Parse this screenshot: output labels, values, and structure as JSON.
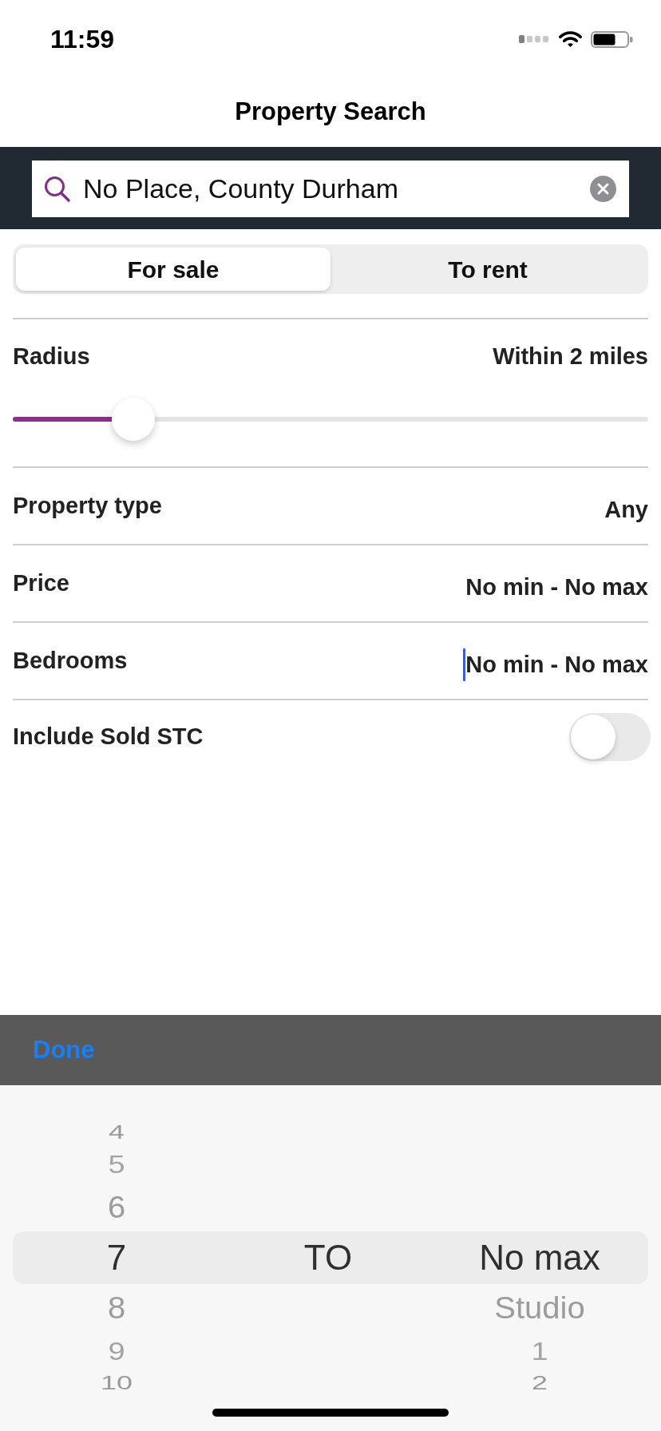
{
  "status_bar": {
    "time": "11:59"
  },
  "nav": {
    "title": "Property Search"
  },
  "search": {
    "value": "No Place, County Durham"
  },
  "tabs": [
    {
      "label": "For sale",
      "selected": true
    },
    {
      "label": "To rent",
      "selected": false
    }
  ],
  "filters": [
    {
      "kind": "slider",
      "label": "Radius",
      "value": "Within 2 miles",
      "level": 0.19
    },
    {
      "kind": "select",
      "label": "Property type",
      "value": "Any",
      "focused": false
    },
    {
      "kind": "select",
      "label": "Price",
      "value": "No min - No max",
      "focused": false
    },
    {
      "kind": "select",
      "label": "Bedrooms",
      "value": "No min - No max",
      "focused": true
    },
    {
      "kind": "toggle",
      "label": "Include Sold STC",
      "on": false
    }
  ],
  "picker": {
    "toolbar": {
      "done": "Done"
    },
    "columns": [
      {
        "kind": "wheel",
        "items": [
          {
            "label": "4",
            "selected": false
          },
          {
            "label": "5",
            "selected": false
          },
          {
            "label": "6",
            "selected": false
          },
          {
            "label": "7",
            "selected": true
          },
          {
            "label": "8",
            "selected": false
          },
          {
            "label": "9",
            "selected": false
          },
          {
            "label": "10",
            "selected": false
          }
        ]
      },
      {
        "kind": "label",
        "text": "TO"
      },
      {
        "kind": "wheel",
        "items": [
          {
            "label": "No max",
            "selected": true
          },
          {
            "label": "Studio",
            "selected": false
          },
          {
            "label": "1",
            "selected": false
          },
          {
            "label": "2",
            "selected": false
          }
        ]
      }
    ]
  }
}
